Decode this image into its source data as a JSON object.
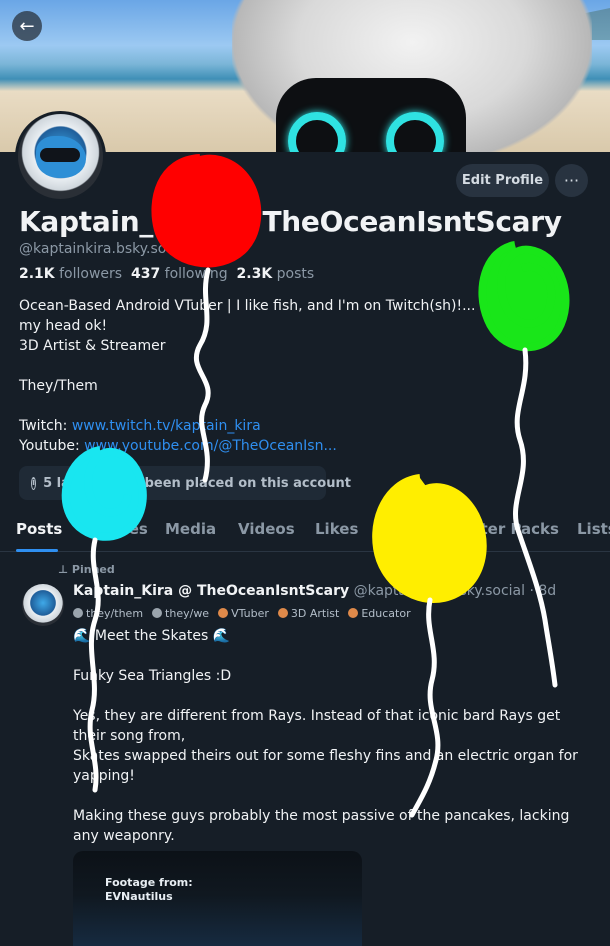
{
  "profile": {
    "display_name": "Kaptain_Kira @ TheOceanIsntScary",
    "handle": "@kaptainkira.bsky.social",
    "followers_count": "2.1K",
    "followers_label": "followers",
    "following_count": "437",
    "following_label": "following",
    "posts_count": "2.3K",
    "posts_label": "posts",
    "bio_line1": "Ocean-Based Android VTuber | I like fish, and I'm on Twitch(sh)!... I'm a fish in my head ok!",
    "bio_line2": "3D Artist & Streamer",
    "bio_line3": "They/Them",
    "twitch_label": "Twitch:",
    "twitch_url": "www.twitch.tv/kaptain_kira",
    "youtube_label": "Youtube:",
    "youtube_url": "www.youtube.com/@TheOceanIsn...",
    "notice": "5 labels have been placed on this account"
  },
  "actions": {
    "edit_profile": "Edit Profile",
    "more": "···",
    "back": "←"
  },
  "tabs": [
    "Posts",
    "Replies",
    "Media",
    "Videos",
    "Likes",
    "Feeds",
    "Starter Packs",
    "Lists"
  ],
  "post": {
    "pinned": "Pinned",
    "author": "Kaptain_Kira @ TheOceanIsntScary",
    "author_handle": "@kaptainkira.bsky.social · 8d",
    "tags": [
      {
        "label": "they/them",
        "color": "#9aa4ad"
      },
      {
        "label": "they/we",
        "color": "#9aa4ad"
      },
      {
        "label": "VTuber",
        "color": "#e08a4a"
      },
      {
        "label": "3D Artist",
        "color": "#e08a4a"
      },
      {
        "label": "Educator",
        "color": "#e08a4a"
      }
    ],
    "paragraphs": [
      "🌊 Meet the Skates 🌊",
      "Funky Sea Triangles :D",
      "Yes, they are different from Rays. Instead of that iconic bard Rays get their song from,\nSkates swapped theirs out for some fleshy fins and an electric organ for yapping!",
      "Making these guys probably the most passive of the pancakes, lacking any weaponry."
    ],
    "media_caption_line1": "Footage from:",
    "media_caption_line2": "EVNautilus"
  },
  "colors": {
    "background": "#161e27",
    "accent": "#2f8ff0",
    "scribble_red": "#ff0000",
    "scribble_green": "#19e619",
    "scribble_cyan": "#19e6f0",
    "scribble_yellow": "#ffee00"
  }
}
